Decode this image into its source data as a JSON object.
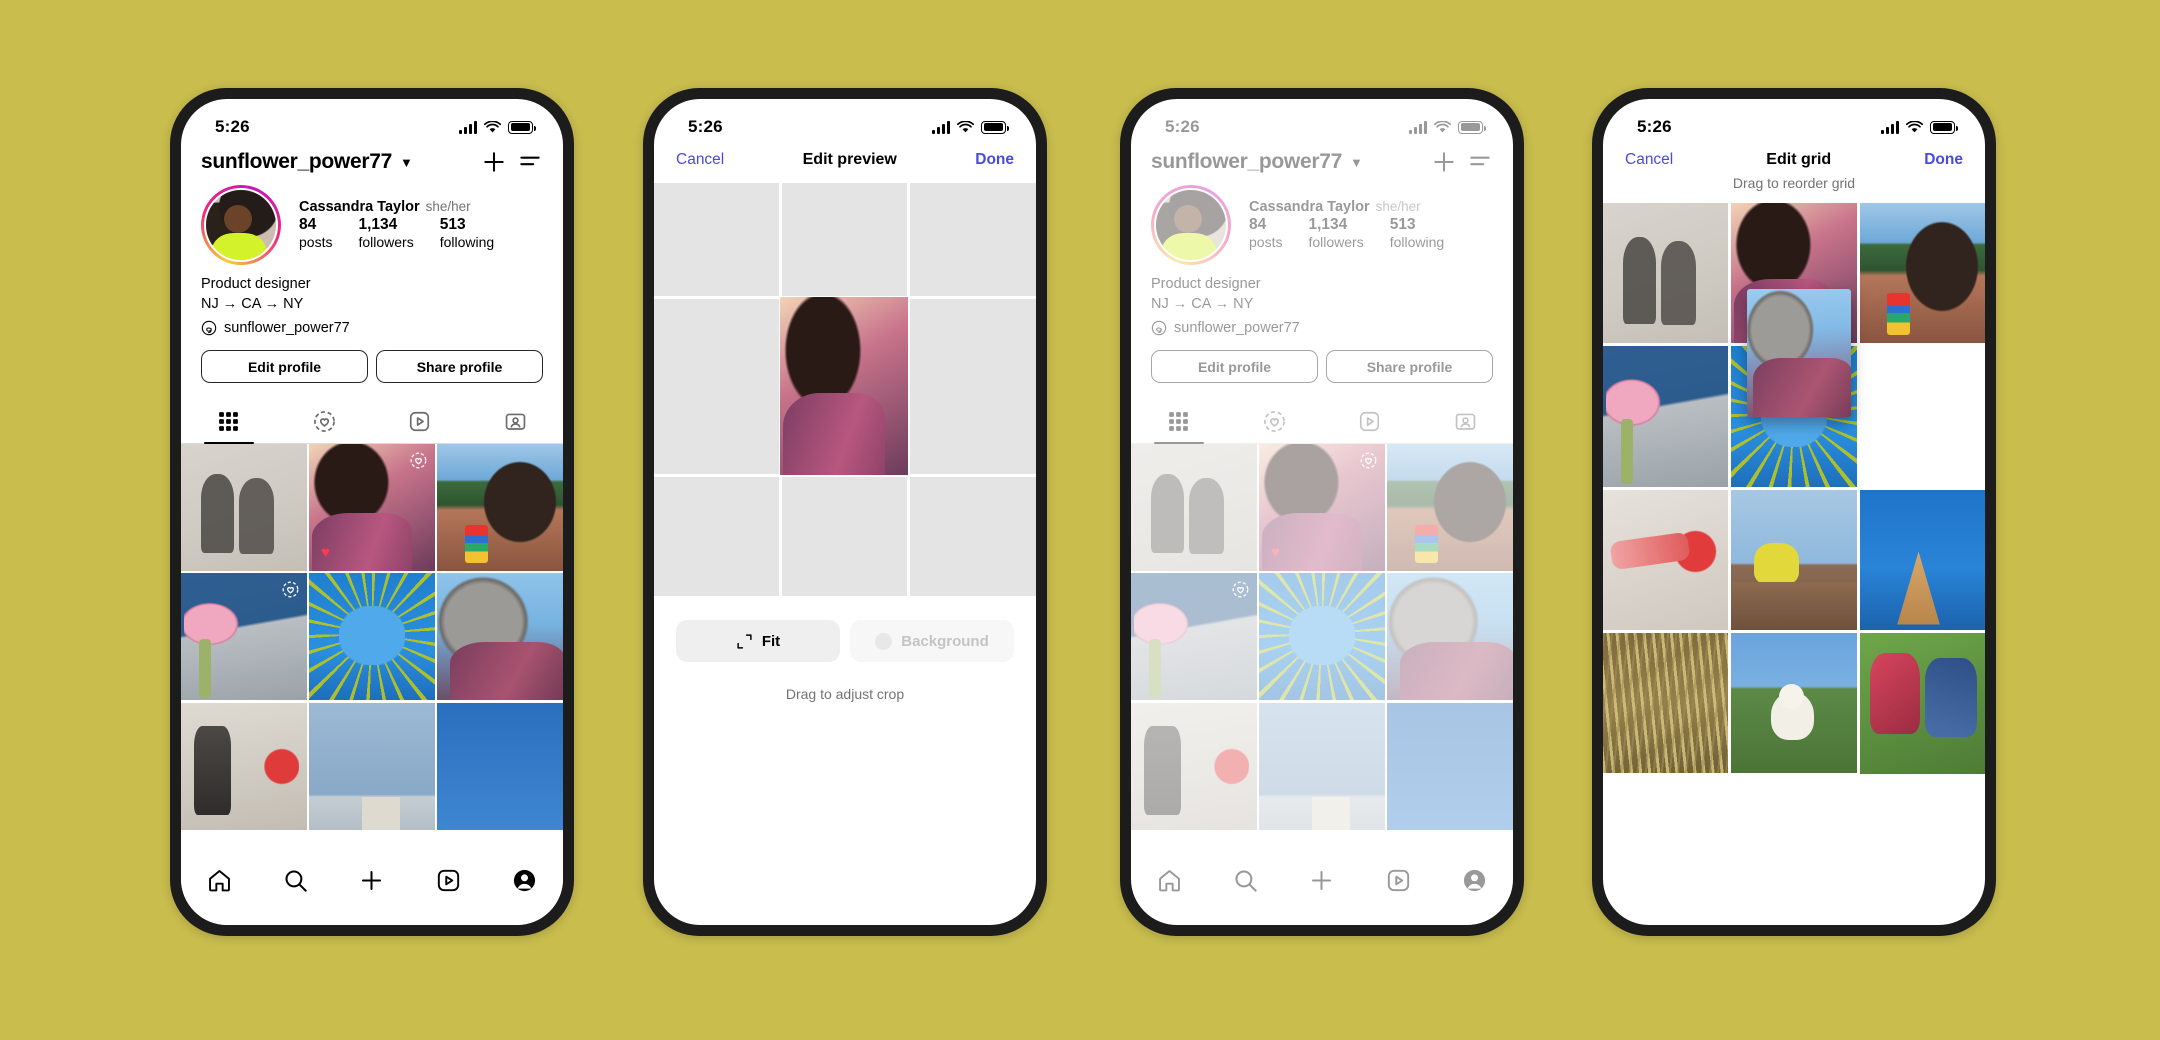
{
  "background_color": "#c9bd4e",
  "accent_blue": "#4a4ae0",
  "status": {
    "time": "5:26"
  },
  "phone1": {
    "name": "instagram-profile-screen",
    "username": "sunflower_power77",
    "chevron": "chevron-down-icon",
    "add_label": "+",
    "stats": [
      {
        "value": "84",
        "label": "posts"
      },
      {
        "value": "1,134",
        "label": "followers"
      },
      {
        "value": "513",
        "label": "following"
      }
    ],
    "full_name": "Cassandra Taylor",
    "pronouns": "she/her",
    "bio_line1": "Product designer",
    "bio_line2": "NJ → CA → NY",
    "threads_handle": "sunflower_power77",
    "buttons": {
      "edit": "Edit profile",
      "share": "Share profile"
    },
    "tabs": [
      {
        "name": "tab-grid",
        "icon": "grid-icon",
        "active": true
      },
      {
        "name": "tab-collections",
        "icon": "reels-heart-icon",
        "active": false
      },
      {
        "name": "tab-reels",
        "icon": "play-square-icon",
        "active": false
      },
      {
        "name": "tab-tagged",
        "icon": "tagged-person-icon",
        "active": false
      }
    ],
    "bottom_nav": [
      {
        "name": "nav-home",
        "icon": "home-icon"
      },
      {
        "name": "nav-search",
        "icon": "search-icon"
      },
      {
        "name": "nav-create",
        "icon": "plus-icon"
      },
      {
        "name": "nav-reels",
        "icon": "reels-icon"
      },
      {
        "name": "nav-profile",
        "icon": "profile-avatar-icon"
      }
    ],
    "grid": [
      {
        "style": "ph-shadow",
        "badge": "",
        "heart": ""
      },
      {
        "style": "ph-hug",
        "badge": "reels-heart-icon",
        "heart": "♥"
      },
      {
        "style": "ph-earring",
        "badge": "",
        "heart": ""
      },
      {
        "style": "ph-flower",
        "badge": "reels-heart-icon",
        "heart": ""
      },
      {
        "style": "ph-dome",
        "badge": "",
        "heart": ""
      },
      {
        "style": "ph-smile",
        "badge": "",
        "heart": ""
      },
      {
        "style": "ph-legs",
        "badge": "",
        "heart": ""
      },
      {
        "style": "ph-skyline",
        "badge": "",
        "heart": ""
      },
      {
        "style": "ph-blue",
        "badge": "",
        "heart": ""
      }
    ]
  },
  "phone2": {
    "name": "edit-preview-screen",
    "cancel": "Cancel",
    "title": "Edit preview",
    "done": "Done",
    "tools": [
      {
        "name": "fit-button",
        "label": "Fit",
        "icon": "crop-corners-icon",
        "disabled": false
      },
      {
        "name": "background-button",
        "label": "Background",
        "icon": "color-dot-icon",
        "disabled": true
      }
    ],
    "hint": "Drag to adjust crop"
  },
  "phone3": {
    "name": "instagram-profile-screen-dimmed",
    "username": "sunflower_power77",
    "stats": [
      {
        "value": "84",
        "label": "posts"
      },
      {
        "value": "1,134",
        "label": "followers"
      },
      {
        "value": "513",
        "label": "following"
      }
    ],
    "full_name": "Cassandra Taylor",
    "pronouns": "she/her",
    "bio_line1": "Product designer",
    "bio_line2": "NJ → CA → NY",
    "threads_handle": "sunflower_power77",
    "buttons": {
      "edit": "Edit profile",
      "share": "Share profile"
    },
    "grid": [
      {
        "style": "ph-shadow",
        "badge": "",
        "heart": ""
      },
      {
        "style": "ph-hug",
        "badge": "reels-heart-icon",
        "heart": "♥"
      },
      {
        "style": "ph-earring",
        "badge": "",
        "heart": ""
      },
      {
        "style": "ph-flower",
        "badge": "reels-heart-icon",
        "heart": ""
      },
      {
        "style": "ph-dome",
        "badge": "",
        "heart": ""
      },
      {
        "style": "ph-smile",
        "badge": "",
        "heart": ""
      },
      {
        "style": "ph-legs",
        "badge": "",
        "heart": ""
      },
      {
        "style": "ph-skyline",
        "badge": "",
        "heart": ""
      },
      {
        "style": "ph-blue",
        "badge": "",
        "heart": ""
      }
    ]
  },
  "phone4": {
    "name": "edit-grid-screen",
    "cancel": "Cancel",
    "title": "Edit grid",
    "done": "Done",
    "hint": "Drag to reorder grid",
    "grid": [
      {
        "style": "ph-shadow"
      },
      {
        "style": "ph-hug"
      },
      {
        "style": "ph-earring"
      },
      {
        "style": "ph-flower"
      },
      {
        "style": "ph-dome"
      },
      {
        "style": "ph-blank"
      },
      {
        "style": "ph-megaphone"
      },
      {
        "style": "ph-building"
      },
      {
        "style": "ph-cone"
      },
      {
        "style": "ph-grass"
      },
      {
        "style": "ph-dog"
      },
      {
        "style": "ph-friends"
      }
    ],
    "dragging_tile": "drag-photo"
  }
}
